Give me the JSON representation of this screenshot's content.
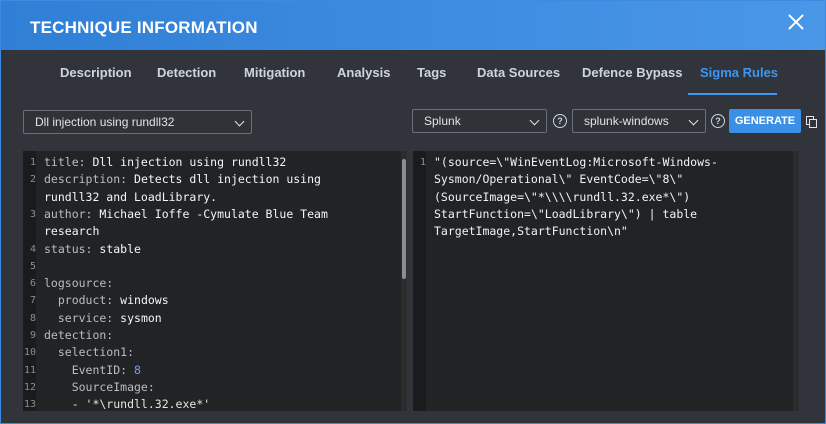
{
  "modal": {
    "title": "TECHNIQUE INFORMATION"
  },
  "tabs": [
    {
      "label": "Description"
    },
    {
      "label": "Detection"
    },
    {
      "label": "Mitigation"
    },
    {
      "label": "Analysis"
    },
    {
      "label": "Tags"
    },
    {
      "label": "Data Sources"
    },
    {
      "label": "Defence Bypass"
    },
    {
      "label": "Sigma Rules"
    }
  ],
  "active_tab": "Sigma Rules",
  "controls": {
    "rule_select": "Dll injection using rundll32",
    "backend_select": "Splunk",
    "config_select": "splunk-windows",
    "help_glyph": "?",
    "generate_label": "GENERATE"
  },
  "yaml": {
    "l1_key": "title:",
    "l1_val": " Dll injection using rundll32",
    "l2_key": "description:",
    "l2_val_a": " Detects dll injection using",
    "l2_val_b": "rundll32 and LoadLibrary.",
    "l3_key": "author:",
    "l3_val_a": " Michael Ioffe -Cymulate Blue Team",
    "l3_val_b": "research",
    "l4_key": "status:",
    "l4_val": " stable",
    "l6_key": "logsource:",
    "l7_key": "  product:",
    "l7_val": " windows",
    "l8_key": "  service:",
    "l8_val": " sysmon",
    "l9_key": "detection:",
    "l10_key": "  selection1:",
    "l11_key": "    EventID:",
    "l11_val": " 8",
    "l12_key": "    SourceImage:",
    "l13_val": "    - '*\\rundll.32.exe*'"
  },
  "line_numbers": [
    "1",
    "2",
    "3",
    "4",
    "5",
    "6",
    "7",
    "8",
    "9",
    "10",
    "11",
    "12",
    "13"
  ],
  "output": {
    "line_number": "1",
    "lines": [
      "\"(source=\\\"WinEventLog:Microsoft-Windows-",
      "Sysmon/Operational\\\" EventCode=\\\"8\\\"",
      "(SourceImage=\\\"*\\\\\\\\rundll.32.exe*\\\")",
      "StartFunction=\\\"LoadLibrary\\\") | table",
      "TargetImage,StartFunction\\n\""
    ]
  },
  "colors": {
    "accent": "#3d97f0",
    "header": "#2f7fd6",
    "background": "#31353b",
    "editor": "#212325",
    "number": "#6f9ef8"
  },
  "icons": {
    "close": "close-icon",
    "copy": "copy-icon",
    "help": "help-icon",
    "dropdown": "chevron-down-icon"
  }
}
